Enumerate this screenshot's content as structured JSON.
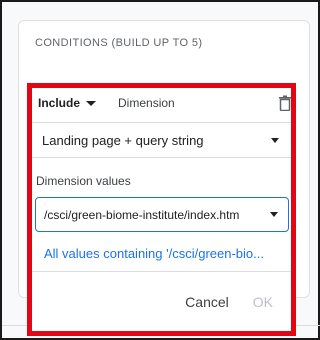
{
  "card": {
    "title": "CONDITIONS (BUILD UP TO 5)"
  },
  "condition": {
    "include_label": "Include",
    "dimension_label": "Dimension",
    "dimension_select": "Landing page + query string",
    "values_label": "Dimension values",
    "values_input": "/csci/green-biome-institute/index.htm",
    "suggestion": "All values containing '/csci/green-bio..."
  },
  "actions": {
    "cancel": "Cancel",
    "ok": "OK"
  },
  "colors": {
    "highlight_border": "#e30613",
    "accent": "#1a73e8"
  }
}
